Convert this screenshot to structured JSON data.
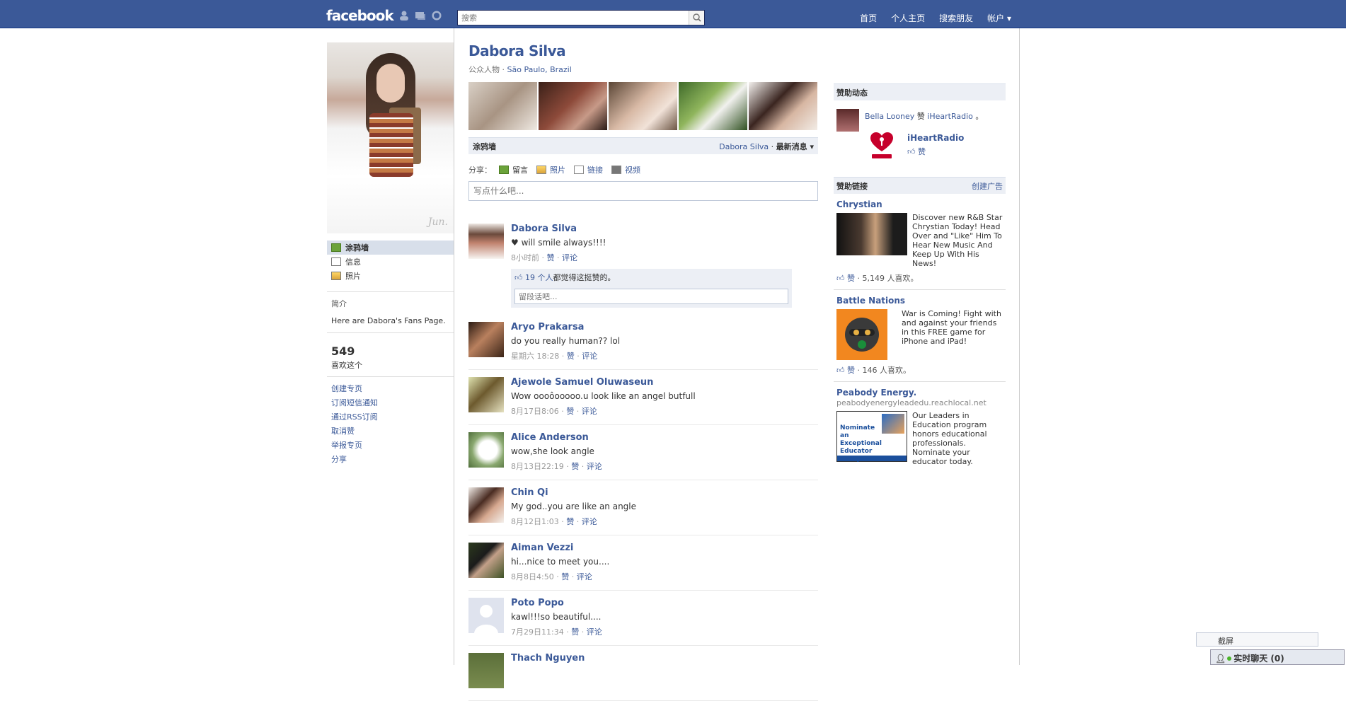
{
  "topbar": {
    "logo": "facebook",
    "search_placeholder": "搜索",
    "nav": [
      "首页",
      "个人主页",
      "搜索朋友",
      "帐户 ▾"
    ]
  },
  "profile": {
    "name": "Dabora Silva",
    "category": "公众人物",
    "location": "São Paulo, Brazil"
  },
  "left_nav": {
    "items": [
      {
        "label": "涂鸦墙"
      },
      {
        "label": "信息"
      },
      {
        "label": "照片"
      }
    ],
    "intro_title": "简介",
    "intro_text": "Here are Dabora's Fans Page.",
    "likes_count": "549",
    "likes_label": "喜欢这个",
    "links": [
      "创建专页",
      "订阅短信通知",
      "通过RSS订阅",
      "取消赞",
      "举报专页",
      "分享"
    ]
  },
  "wall": {
    "title": "涂鸦墙",
    "filter_name": "Dabora Silva",
    "filter_sep": " · ",
    "filter_option": "最新消息 ▾",
    "share_label": "分享：",
    "share_items": [
      "留言",
      "照片",
      "链接",
      "视频"
    ],
    "status_placeholder": "写点什么吧..."
  },
  "posts": [
    {
      "author": "Dabora Silva",
      "text": "♥ will smile always!!!!",
      "time": "8小时前",
      "like": "赞",
      "comment": "评论",
      "likes_link": "19 个人",
      "likes_suffix": "都觉得这挺赞的。",
      "comment_placeholder": "留段话吧..."
    },
    {
      "author": "Aryo Prakarsa",
      "text": "do you really human?? lol",
      "time": "星期六 18:28",
      "like": "赞",
      "comment": "评论"
    },
    {
      "author": "Ajewole Samuel Oluwaseun",
      "text": "Wow oooôooooo.u look like an angel butfull",
      "time": "8月17日8:06",
      "like": "赞",
      "comment": "评论"
    },
    {
      "author": "Alice Anderson",
      "text": "wow,she look angle",
      "time": "8月13日22:19",
      "like": "赞",
      "comment": "评论"
    },
    {
      "author": "Chin Qi",
      "text": "My god..you are like an angle",
      "time": "8月12日1:03",
      "like": "赞",
      "comment": "评论"
    },
    {
      "author": "Aiman Vezzi",
      "text": "hi...nice to meet you....",
      "time": "8月8日4:50",
      "like": "赞",
      "comment": "评论"
    },
    {
      "author": "Poto Popo",
      "text": "kawl!!!so beautiful....",
      "time": "7月29日11:34",
      "like": "赞",
      "comment": "评论"
    },
    {
      "author": "Thach Nguyen",
      "text": "",
      "time": "",
      "like": "",
      "comment": ""
    }
  ],
  "sponsored_activity": {
    "title": "赞助动态",
    "user": "Bella Looney",
    "verb": " 赞 ",
    "target": "iHeartRadio",
    "suffix": " 。",
    "page_name": "iHeartRadio",
    "like": "赞"
  },
  "ads": {
    "title": "赞助链接",
    "create_link": "创建广告",
    "items": [
      {
        "title": "Chrystian",
        "url": "",
        "text": "Discover new R&B Star Chrystian Today! Head Over and \"Like\" Him To Hear New Music And Keep Up With His News!",
        "like": "赞",
        "count": "5,149 人喜欢。"
      },
      {
        "title": "Battle Nations",
        "url": "",
        "text": "War is Coming! Fight with and against your friends in this FREE game for iPhone and iPad!",
        "like": "赞",
        "count": "146 人喜欢。"
      },
      {
        "title": "Peabody Energy.",
        "url": "peabodyenergyleadedu.reachlocal.net",
        "text": "Our Leaders in Education program honors educational professionals. Nominate your educator today.",
        "img_text": "Nominate an Exceptional Educator Today!"
      }
    ]
  },
  "dock": {
    "screenshot": "截屏",
    "chat": "实时聊天 (0)"
  },
  "colors": {
    "brand": "#3b5998",
    "bar_border": "#133783",
    "panel": "#eceff5"
  }
}
